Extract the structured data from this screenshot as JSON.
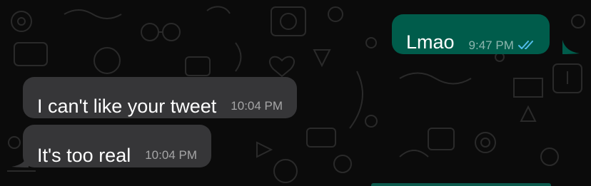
{
  "chat": {
    "messages": [
      {
        "direction": "outgoing",
        "text": "Lmao",
        "time": "9:47 PM",
        "status_icon": "double-check-read-icon"
      },
      {
        "direction": "incoming",
        "text": "I can't like your tweet",
        "time": "10:04 PM"
      },
      {
        "direction": "incoming",
        "text": "It's too real",
        "time": "10:04 PM"
      }
    ],
    "colors": {
      "background": "#0b0b0b",
      "incoming_bubble": "#363638",
      "outgoing_bubble": "#005c4b",
      "read_ticks": "#53bdeb"
    }
  }
}
